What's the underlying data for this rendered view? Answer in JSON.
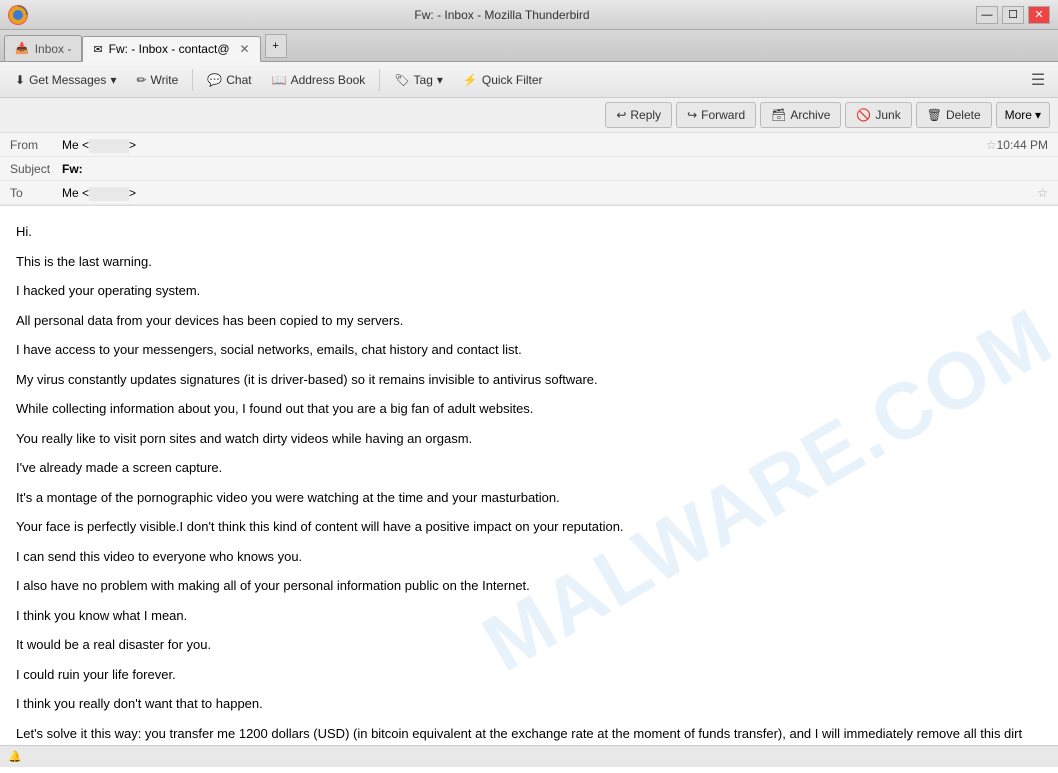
{
  "window": {
    "title": "Fw: - Inbox - Mozilla Thunderbird"
  },
  "tabs": [
    {
      "id": "tab-inbox",
      "label": "Inbox - ",
      "icon": "📥",
      "active": false
    },
    {
      "id": "tab-fw",
      "label": "Fw: - Inbox - contact@",
      "icon": "✉",
      "active": true,
      "closeable": true
    }
  ],
  "toolbar": {
    "get_messages_label": "Get Messages",
    "write_label": "Write",
    "chat_label": "Chat",
    "address_book_label": "Address Book",
    "tag_label": "Tag",
    "quick_filter_label": "Quick Filter"
  },
  "action_buttons": {
    "reply_label": "Reply",
    "forward_label": "Forward",
    "archive_label": "Archive",
    "junk_label": "Junk",
    "delete_label": "Delete",
    "more_label": "More"
  },
  "message": {
    "from_label": "From",
    "from_value": "Me <",
    "from_email": "                    ",
    "from_suffix": ">",
    "subject_label": "Subject",
    "subject_value": "Fw:",
    "to_label": "To",
    "to_value": "Me <",
    "to_email": "                    ",
    "to_suffix": ">",
    "time": "10:44 PM",
    "body_lines": [
      "Hi.",
      "This is the last warning.",
      "I hacked your operating system.",
      "All personal data from your devices has been copied to my servers.",
      "I have access to your messengers, social networks, emails, chat history and contact list.",
      "My virus constantly updates signatures (it is driver-based) so it remains invisible to antivirus software.",
      "While collecting information about you, I found out that you are a big fan of adult websites.",
      "You really like to visit porn sites and watch dirty videos while having an orgasm.",
      "I've already made a screen capture.",
      "It's a montage of the pornographic video you were watching at the time and your masturbation.",
      "Your face is perfectly visible.I don't think this kind of content will have a positive impact on your reputation.",
      "I can send this video to everyone who knows you.",
      "I also have no problem with making all of your personal information public on the Internet.",
      "I think you know what I mean.",
      "It would be a real disaster for you.",
      "I could ruin your life forever.",
      "I think you really don't want that to happen.",
      "Let's solve it this way: you transfer me 1200 dollars (USD) (in bitcoin equivalent at the exchange rate at the moment of funds transfer), and I will immediately remove all this dirt from my servers."
    ],
    "watermark": "MALWARE.COM"
  },
  "status_bar": {
    "icon_label": "notification-icon",
    "text": ""
  }
}
